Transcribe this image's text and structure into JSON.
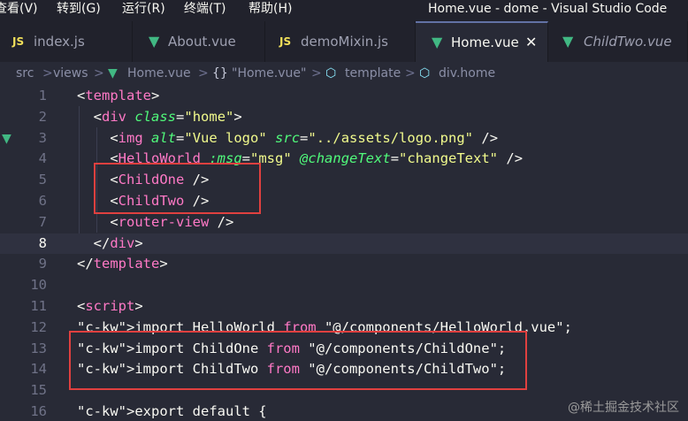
{
  "menu": {
    "items": [
      "查看(V)",
      "转到(G)",
      "运行(R)",
      "终端(T)",
      "帮助(H)"
    ]
  },
  "window": {
    "title": "Home.vue - dome - Visual Studio Code"
  },
  "tabs": [
    {
      "label": "index.js",
      "icon": "JS",
      "active": false,
      "italic": false
    },
    {
      "label": "About.vue",
      "icon": "vue-icon",
      "active": false,
      "italic": false
    },
    {
      "label": "demoMixin.js",
      "icon": "JS",
      "active": false,
      "italic": false
    },
    {
      "label": "Home.vue",
      "icon": "vue-icon",
      "active": true,
      "italic": false,
      "close": "✕"
    },
    {
      "label": "ChildTwo.vue",
      "icon": "vue-icon",
      "active": false,
      "italic": true
    }
  ],
  "breadcrumb": {
    "items": [
      "src",
      "views",
      "Home.vue",
      "\"Home.vue\"",
      "template",
      "div.home"
    ],
    "separator": ">"
  },
  "editor": {
    "lines": [
      {
        "n": "1",
        "text": "<template>"
      },
      {
        "n": "2",
        "text": "  <div class=\"home\">"
      },
      {
        "n": "3",
        "text": "    <img alt=\"Vue logo\" src=\"../assets/logo.png\" />"
      },
      {
        "n": "4",
        "text": "    <HelloWorld :msg=\"msg\" @changeText=\"changeText\" />"
      },
      {
        "n": "5",
        "text": "    <ChildOne />"
      },
      {
        "n": "6",
        "text": "    <ChildTwo />"
      },
      {
        "n": "7",
        "text": "    <router-view />"
      },
      {
        "n": "8",
        "text": "  </div>"
      },
      {
        "n": "9",
        "text": "</template>"
      },
      {
        "n": "10",
        "text": ""
      },
      {
        "n": "11",
        "text": "<script>"
      },
      {
        "n": "12",
        "text": "import HelloWorld from \"@/components/HelloWorld.vue\";"
      },
      {
        "n": "13",
        "text": "import ChildOne from \"@/components/ChildOne\";"
      },
      {
        "n": "14",
        "text": "import ChildTwo from \"@/components/ChildTwo\";"
      },
      {
        "n": "15",
        "text": ""
      },
      {
        "n": "16",
        "text": "export default {"
      }
    ],
    "current_line": "8"
  },
  "watermark": "@稀土掘金技术社区",
  "colors": {
    "highlight_box": "#e0403f",
    "vue_green": "#41b883",
    "tag_pink": "#ff79c6",
    "attr_green": "#50fa7b",
    "string_yellow": "#f1fa8c"
  }
}
